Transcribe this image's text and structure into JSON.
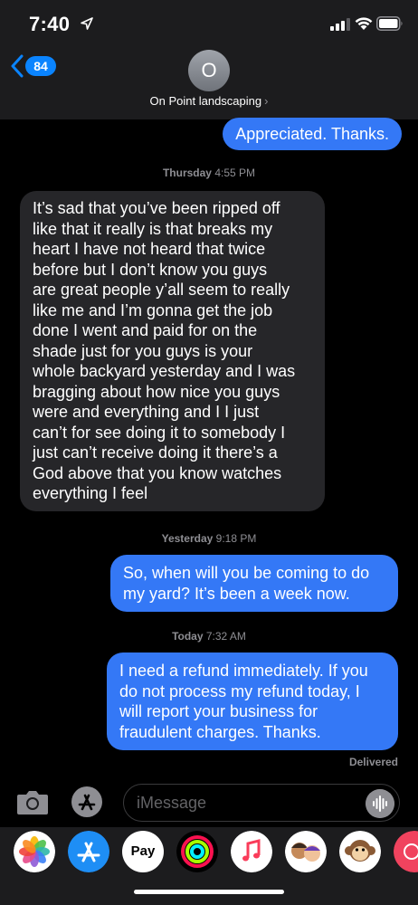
{
  "status": {
    "time": "7:40"
  },
  "nav": {
    "back_count": "84",
    "avatar_initial": "O",
    "contact_name": "On Point landscaping",
    "contact_chevron": "›"
  },
  "messages": [
    {
      "id": "m1",
      "side": "out",
      "text": "Appreciated. Thanks."
    },
    {
      "id": "m2",
      "side": "in",
      "lines": [
        "It’s sad that you’ve been ripped off",
        "like that it really is that breaks my",
        "heart I have not heard that twice",
        "before but I don’t know you guys",
        "are great people y’all seem to really",
        "like me and I’m gonna get the job",
        "done I went and paid for on the",
        "shade just for you guys is your",
        "whole backyard yesterday and I was",
        "bragging about how nice you guys",
        "were and everything and I I just",
        "can’t for see doing it to somebody I",
        "just can’t receive doing it there’s a",
        "God above that you know watches",
        "everything I feel"
      ]
    },
    {
      "id": "m3",
      "side": "out",
      "lines": [
        "So, when will you be coming to do",
        "my yard? It’s been a week now."
      ]
    },
    {
      "id": "m4",
      "side": "out",
      "lines": [
        "I need a refund immediately. If you",
        "do not process my refund today, I",
        "will report your business for",
        "fraudulent charges. Thanks."
      ]
    }
  ],
  "timestamps": [
    {
      "day": "Thursday",
      "time": "4:55 PM"
    },
    {
      "day": "Yesterday",
      "time": "9:18 PM"
    },
    {
      "day": "Today",
      "time": "7:32 AM"
    }
  ],
  "delivered_label": "Delivered",
  "composer": {
    "placeholder": "iMessage"
  },
  "dock": {
    "apple_pay_label": "Pay",
    "apple_glyph": ""
  },
  "colors": {
    "outgoing_bubble": "#3478f6",
    "incoming_bubble": "#262629",
    "accent": "#0a84ff"
  },
  "icons": [
    "location-arrow-icon",
    "cellular-signal-icon",
    "wifi-icon",
    "battery-icon",
    "back-chevron-icon",
    "camera-icon",
    "app-store-icon",
    "audio-waveform-icon",
    "photos-app-icon",
    "music-app-icon",
    "activity-app-icon",
    "memoji-icon"
  ]
}
